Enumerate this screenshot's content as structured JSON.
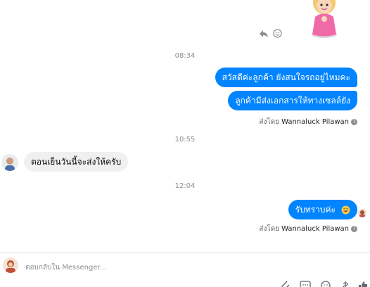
{
  "colors": {
    "outgoing_bubble": "#0084ff",
    "incoming_bubble": "#f0f0f0",
    "timestamp": "#8a8d91"
  },
  "sticker": {
    "icon": "pink-doll-sticker"
  },
  "timestamps": [
    "08:34",
    "10:55",
    "12:04"
  ],
  "messages": {
    "m1": "สวัสดีค่ะลูกค้า ยังสนใจรถอยู่ไหมคะ",
    "m2": "ลูกค้ามีส่งเอกสารให้ทางเซลล์ยัง",
    "m3": "ตอนเย็นวันนี้จะส่งให้ครับ",
    "m4": "รับทราบค่ะ"
  },
  "sent_by": {
    "prefix": "ส่งโดย",
    "name": "Wannaluck Pilawan"
  },
  "composer": {
    "placeholder": "ตอบกลับใน Messenger..."
  }
}
